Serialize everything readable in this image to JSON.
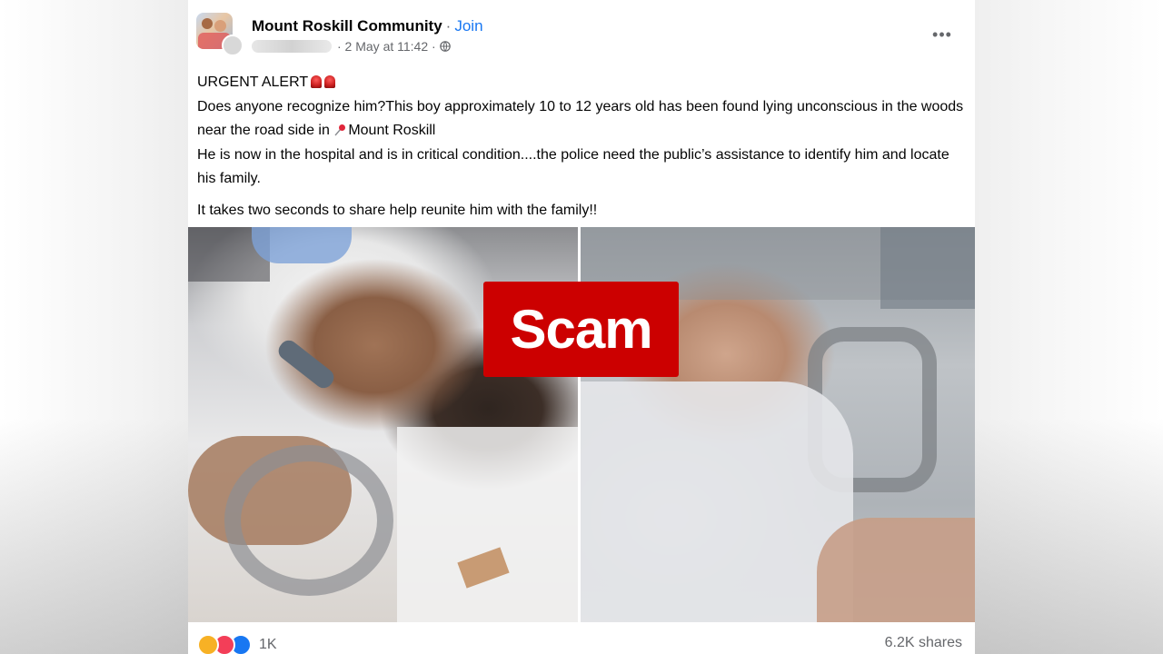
{
  "post": {
    "group_name": "Mount Roskill Community",
    "separator": "·",
    "join_label": "Join",
    "timestamp": "· 2 May at 11:42 ·",
    "more_label": "•••",
    "body": {
      "line1_text": "URGENT ALERT",
      "para1_text_a": "Does anyone recognize him?This boy approximately  10 to 12  years old has been found lying unconscious in the woods near the road side in ",
      "para1_location": "Mount Roskill",
      "para1_text_b": "He is now in the hospital and is in critical condition....the police need the public’s assistance to identify him and locate his family.",
      "para2_text": "It takes two seconds to share help reunite him with the family!!"
    },
    "overlay_label": "Scam",
    "reaction_count": "1K",
    "shares_label": "6.2K shares"
  },
  "colors": {
    "accent_blue": "#1877f2",
    "scam_red": "#cc0000",
    "meta_gray": "#65676b"
  },
  "icons": [
    "globe-icon",
    "siren-emoji-icon",
    "pin-emoji-icon",
    "sad-reaction-icon",
    "love-reaction-icon",
    "like-reaction-icon",
    "more-options-icon"
  ]
}
